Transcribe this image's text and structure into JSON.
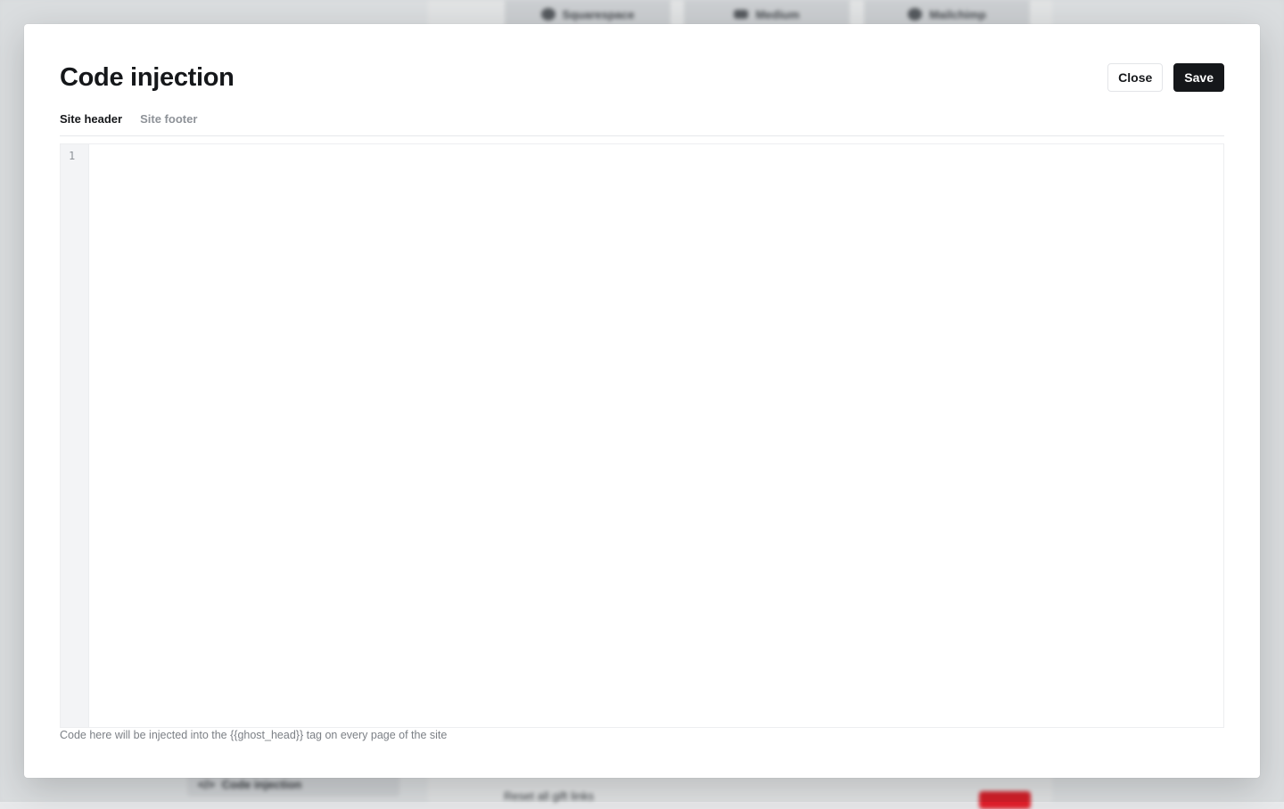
{
  "background": {
    "import_buttons": [
      {
        "label": "Squarespace",
        "icon": "squarespace-icon"
      },
      {
        "label": "Medium",
        "icon": "medium-icon"
      },
      {
        "label": "Mailchimp",
        "icon": "mailchimp-icon"
      }
    ],
    "nav_item_label": "Code injection",
    "reset_text": "Reset all gift links"
  },
  "modal": {
    "title": "Code injection",
    "close_label": "Close",
    "save_label": "Save",
    "tabs": [
      {
        "label": "Site header",
        "active": true
      },
      {
        "label": "Site footer",
        "active": false
      }
    ],
    "editor": {
      "line_numbers": [
        "1"
      ],
      "content": ""
    },
    "hint": "Code here will be injected into the {{ghost_head}} tag on every page of the site"
  },
  "colors": {
    "primary_button": "#15171a",
    "muted_text": "#8e9298",
    "danger": "#e3202b"
  }
}
